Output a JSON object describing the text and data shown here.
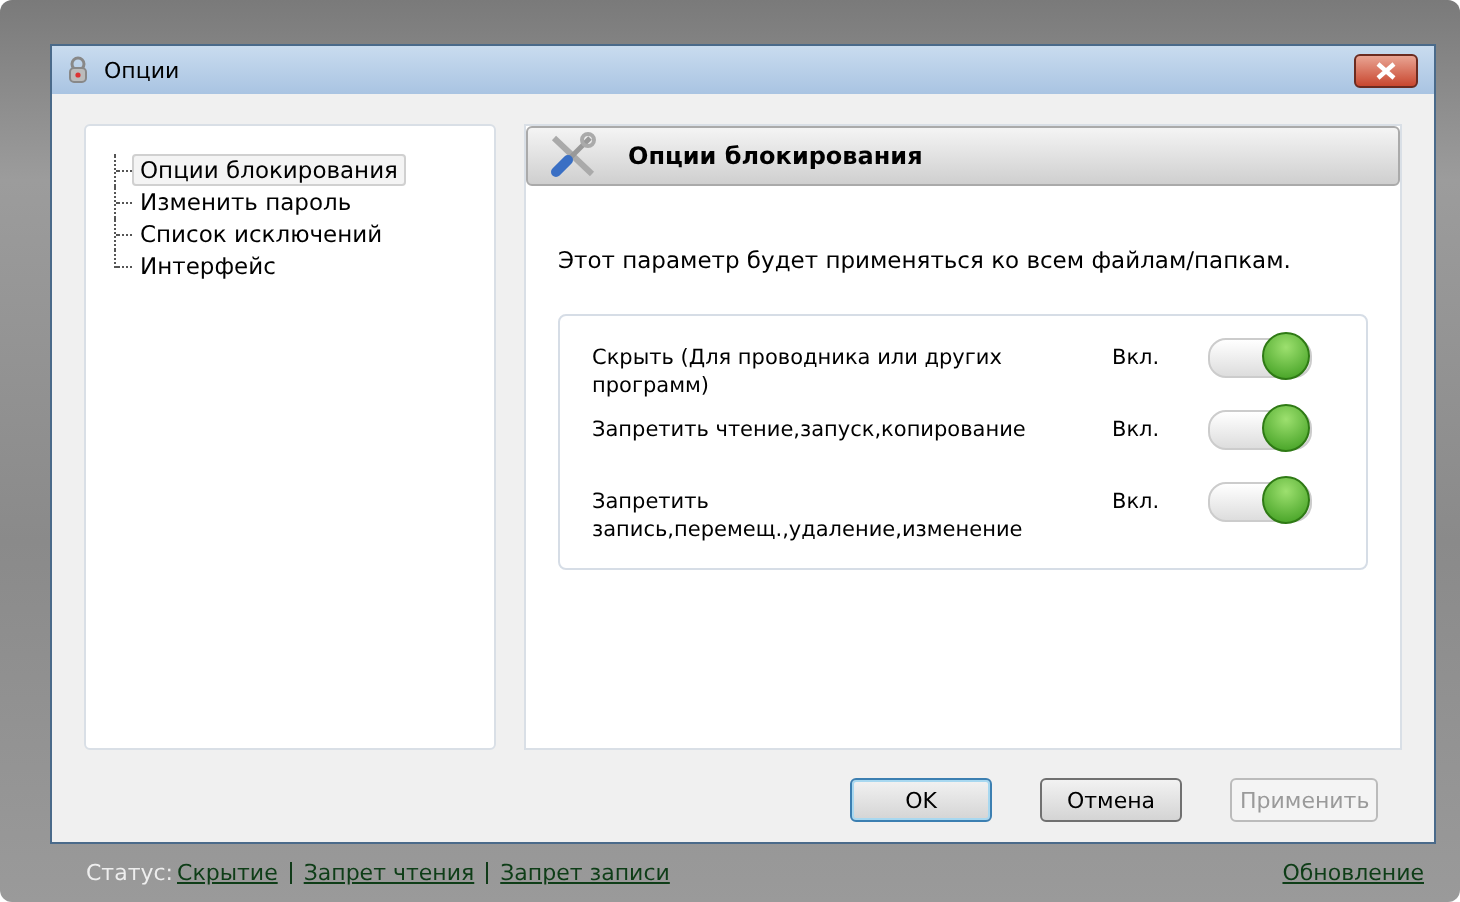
{
  "window": {
    "title": "Опции"
  },
  "tree": [
    {
      "label": "Опции блокирования",
      "selected": true
    },
    {
      "label": "Изменить пароль",
      "selected": false
    },
    {
      "label": "Список исключений",
      "selected": false
    },
    {
      "label": "Интерфейс",
      "selected": false
    }
  ],
  "panel": {
    "title": "Опции блокирования",
    "description": "Этот параметр будет применяться ко всем файлам/папкам.",
    "options": [
      {
        "label": "Скрыть (Для проводника или других программ)",
        "state": "Вкл.",
        "on": true
      },
      {
        "label": "Запретить чтение,запуск,копирование",
        "state": "Вкл.",
        "on": true
      },
      {
        "label": "Запретить запись,перемещ.,удаление,изменение",
        "state": "Вкл.",
        "on": true
      }
    ]
  },
  "buttons": [
    {
      "label": "OK",
      "default": true,
      "disabled": false
    },
    {
      "label": "Отмена",
      "default": false,
      "disabled": false
    },
    {
      "label": "Применить",
      "default": false,
      "disabled": true
    }
  ],
  "status_bar": {
    "label": "Статус:",
    "links": [
      "Скрытие",
      "Запрет чтения",
      "Запрет записи"
    ],
    "update": "Обновление"
  }
}
